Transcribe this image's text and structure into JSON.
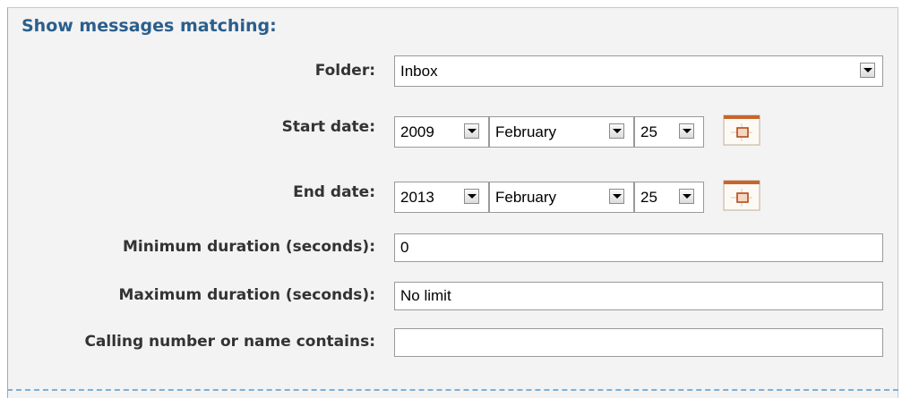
{
  "heading": "Show messages matching:",
  "folder": {
    "label": "Folder:",
    "value": "Inbox"
  },
  "start_date": {
    "label": "Start date:",
    "year": "2009",
    "month": "February",
    "day": "25"
  },
  "end_date": {
    "label": "End date:",
    "year": "2013",
    "month": "February",
    "day": "25"
  },
  "min_duration": {
    "label": "Minimum duration (seconds):",
    "value": "0"
  },
  "max_duration": {
    "label": "Maximum duration (seconds):",
    "value": "No limit"
  },
  "calling_number": {
    "label": "Calling number or name contains:",
    "value": ""
  },
  "icons": {
    "calendar": "calendar-icon",
    "dropdown": "chevron-down-icon"
  }
}
